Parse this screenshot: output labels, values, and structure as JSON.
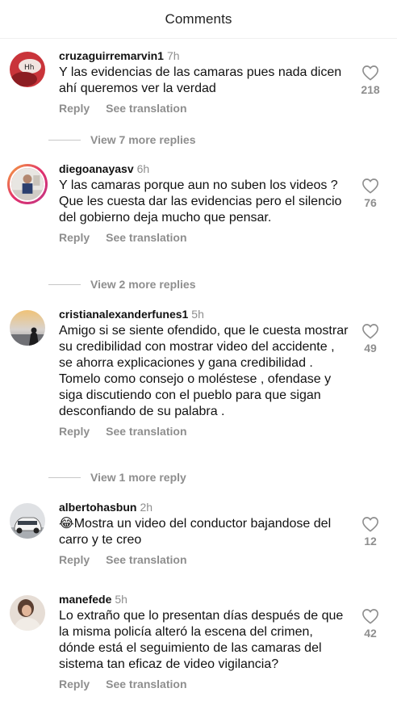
{
  "header": {
    "title": "Comments"
  },
  "comments": [
    {
      "username": "cruzaguirremarvin1",
      "time": "7h",
      "text": "Y las evidencias de las camaras pues nada dicen ahí queremos ver la verdad",
      "likes": "218",
      "reply_label": "Reply",
      "translate_label": "See translation",
      "view_replies": "View 7 more replies"
    },
    {
      "username": "diegoanayasv",
      "time": "6h",
      "text": "Y las camaras porque aun no suben los videos ? Que les cuesta dar las evidencias pero el silencio del gobierno deja mucho que pensar.",
      "likes": "76",
      "reply_label": "Reply",
      "translate_label": "See translation",
      "view_replies": "View 2 more replies"
    },
    {
      "username": "cristianalexanderfunes1",
      "time": "5h",
      "text": "Amigo si se siente ofendido, que le cuesta mostrar su credibilidad con mostrar video del accidente , se ahorra explicaciones y gana credibilidad . Tomelo como consejo o moléstese , ofendase y siga discutiendo con el pueblo para que sigan desconfiando de su palabra .",
      "likes": "49",
      "reply_label": "Reply",
      "translate_label": "See translation",
      "view_replies": "View 1 more reply"
    },
    {
      "username": "albertohasbun",
      "time": "2h",
      "text": "😂Mostra un video del conductor bajandose del carro y te creo",
      "likes": "12",
      "reply_label": "Reply",
      "translate_label": "See translation"
    },
    {
      "username": "manefede",
      "time": "5h",
      "text": "Lo extraño que lo presentan días después de que la misma policía alteró la escena del crimen, dónde está el seguimiento de las camaras del sistema tan eficaz de video vigilancia?",
      "likes": "42",
      "reply_label": "Reply",
      "translate_label": "See translation"
    }
  ],
  "colors": {
    "muted": "#8e8e8e",
    "text": "#111111",
    "story_ring": "#e1306c"
  }
}
